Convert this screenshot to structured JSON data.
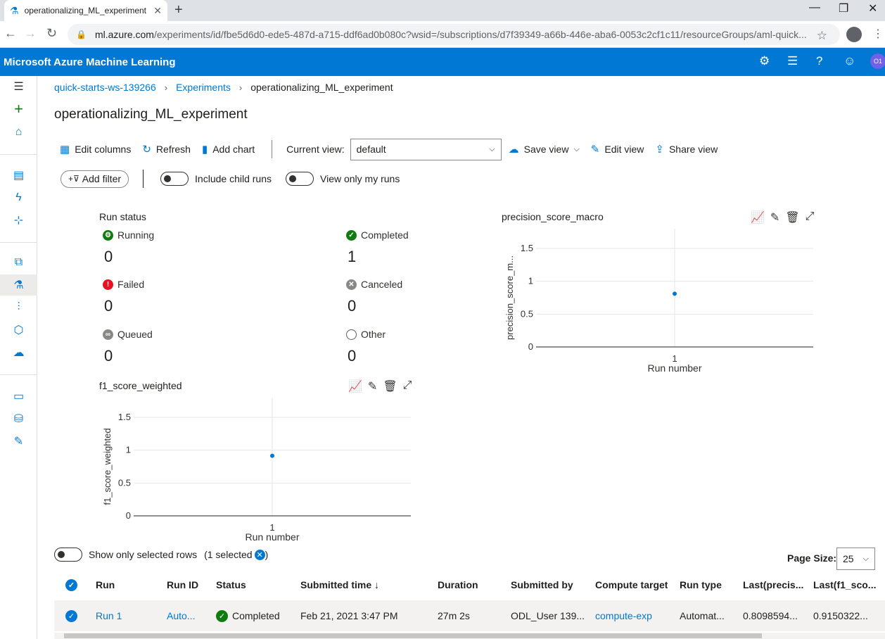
{
  "browser": {
    "tab_title": "operationalizing_ML_experiment",
    "url_domain": "ml.azure.com",
    "url_path": "/experiments/id/fbe5d6d0-ede5-487d-a715-ddf6ad0b080c?wsid=/subscriptions/d7f39349-a66b-446e-aba6-0053c2cf1c11/resourceGroups/aml-quick..."
  },
  "header": {
    "brand": "Microsoft Azure Machine Learning",
    "avatar_initials": "O1"
  },
  "breadcrumb": [
    "quick-starts-ws-139266",
    "Experiments",
    "operationalizing_ML_experiment"
  ],
  "page_title": "operationalizing_ML_experiment",
  "toolbar": {
    "edit_columns": "Edit columns",
    "refresh": "Refresh",
    "add_chart": "Add chart",
    "current_view_label": "Current view:",
    "current_view_value": "default",
    "save_view": "Save view",
    "edit_view": "Edit view",
    "share_view": "Share view"
  },
  "filters": {
    "add_filter": "Add filter",
    "include_child_runs": "Include child runs",
    "view_only_my_runs": "View only my runs"
  },
  "run_status": {
    "title": "Run status",
    "running_label": "Running",
    "running_count": "0",
    "completed_label": "Completed",
    "completed_count": "1",
    "failed_label": "Failed",
    "failed_count": "0",
    "canceled_label": "Canceled",
    "canceled_count": "0",
    "queued_label": "Queued",
    "queued_count": "0",
    "other_label": "Other",
    "other_count": "0"
  },
  "chart_data": [
    {
      "type": "scatter",
      "title": "precision_score_macro",
      "xlabel": "Run number",
      "ylabel": "precision_score_m...",
      "x": [
        1
      ],
      "y": [
        0.81
      ],
      "xticks": [
        "1"
      ],
      "yticks": [
        "0",
        "0.5",
        "1",
        "1.5"
      ],
      "ylim": [
        0,
        1.5
      ],
      "color": "#0078d4"
    },
    {
      "type": "scatter",
      "title": "f1_score_weighted",
      "xlabel": "Run number",
      "ylabel": "f1_score_weighted",
      "x": [
        1
      ],
      "y": [
        0.915
      ],
      "xticks": [
        "1"
      ],
      "yticks": [
        "0",
        "0.5",
        "1",
        "1.5"
      ],
      "ylim": [
        0,
        1.5
      ],
      "color": "#0078d4"
    }
  ],
  "table": {
    "show_selected_label": "Show only selected rows",
    "selected_count_text": "(1 selected",
    "selected_close": ")",
    "page_size_label": "Page Size:",
    "page_size_value": "25",
    "headers": [
      "Run",
      "Run ID",
      "Status",
      "Submitted time ↓",
      "Duration",
      "Submitted by",
      "Compute target",
      "Run type",
      "Last(precis...",
      "Last(f1_sco..."
    ],
    "rows": [
      [
        "Run 1",
        "Auto...",
        "Completed",
        "Feb 21, 2021 3:47 PM",
        "27m 2s",
        "ODL_User 139...",
        "compute-exp",
        "Automat...",
        "0.8098594...",
        "0.9150322..."
      ]
    ]
  },
  "colors": {
    "accent": "#0078d4",
    "success": "#107c10",
    "error": "#e81123",
    "neutral": "#8a8886"
  }
}
